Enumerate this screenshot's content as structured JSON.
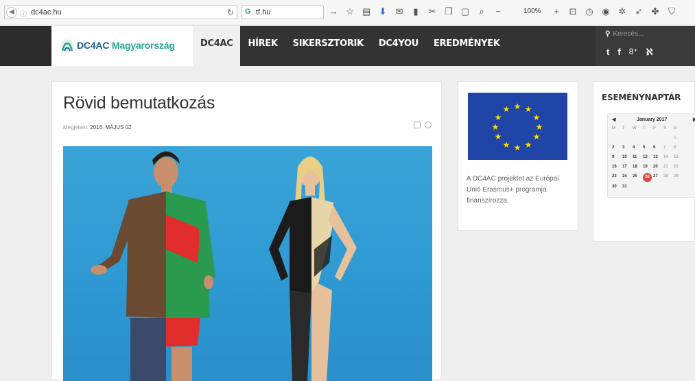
{
  "browser": {
    "url": "dc4ac.hu",
    "search_value": "tf.hu",
    "zoom": "100%"
  },
  "header": {
    "logo_text_part1": "DC4AC",
    "logo_text_part2": "Magyarország",
    "search_placeholder": "Keresés...",
    "nav": [
      {
        "label": "DC4AC",
        "active": true
      },
      {
        "label": "HÍREK",
        "active": false
      },
      {
        "label": "SIKERSZTORIK",
        "active": false
      },
      {
        "label": "DC4YOU",
        "active": false
      },
      {
        "label": "EREDMÉNYEK",
        "active": false
      }
    ],
    "social_icons": [
      "twitter-icon",
      "facebook-icon",
      "google-plus-icon",
      "rss-icon"
    ]
  },
  "article": {
    "title": "Rövid bemutatkozás",
    "meta_prefix": "Megjelent:",
    "meta_date": "2016. MÁJUS 02"
  },
  "eu": {
    "text": "A DC4AC projektet az Európai Unió Erasmus+ programja finanszírozza."
  },
  "calendar": {
    "title": "ESEMÉNYNAPTÁR",
    "month": "January 2017",
    "weekdays": [
      "M",
      "T",
      "W",
      "T",
      "F",
      "S",
      "S"
    ],
    "weeks": [
      [
        "",
        "",
        "",
        "",
        "",
        "",
        "1"
      ],
      [
        "2",
        "3",
        "4",
        "5",
        "6",
        "7",
        "8"
      ],
      [
        "9",
        "10",
        "11",
        "12",
        "13",
        "14",
        "15"
      ],
      [
        "16",
        "17",
        "18",
        "19",
        "20",
        "21",
        "22"
      ],
      [
        "23",
        "24",
        "25",
        "26",
        "27",
        "28",
        "29"
      ],
      [
        "30",
        "31",
        "",
        "",
        "",
        "",
        ""
      ]
    ],
    "today": "26",
    "colors": {
      "today": "#e0443a"
    }
  },
  "colors": {
    "header_bg": "#333333",
    "brand_blue": "#1a5d8a",
    "brand_green": "#23a78a",
    "eu_blue": "#1f45a6",
    "eu_star": "#ffdd00"
  }
}
